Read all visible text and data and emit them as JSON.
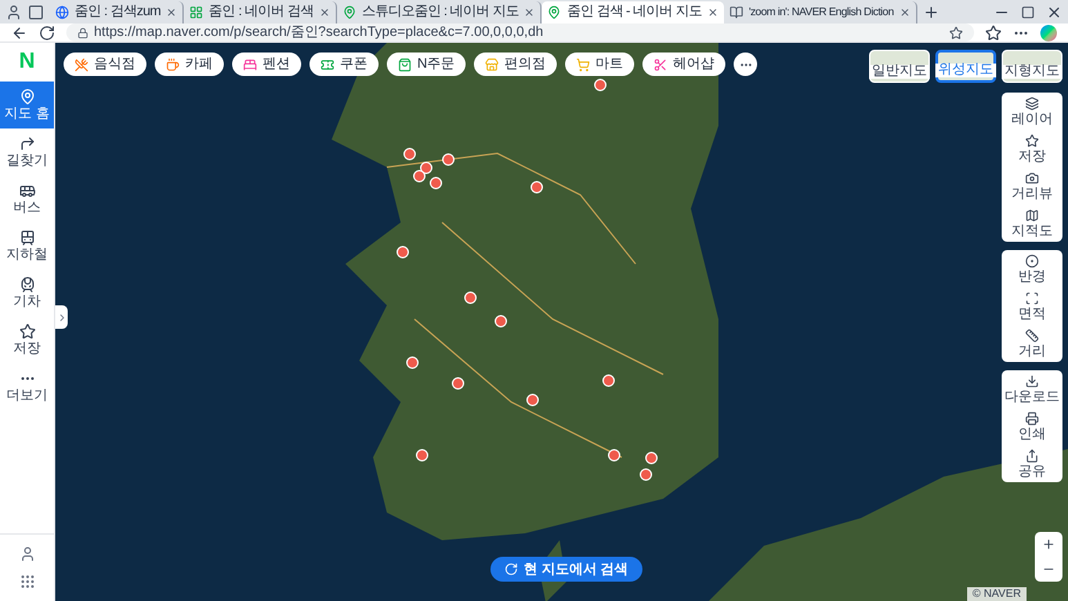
{
  "browser": {
    "tabs": [
      {
        "title": "줌인 : 검색zum",
        "kind": "zum",
        "selected": false
      },
      {
        "title": "줌인 : 네이버 검색",
        "kind": "naver",
        "selected": false
      },
      {
        "title": "스튜디오줌인 : 네이버 지도",
        "kind": "map",
        "selected": false
      },
      {
        "title": "줌인 검색 - 네이버 지도",
        "kind": "map",
        "selected": true
      },
      {
        "title": "'zoom in': NAVER English Diction",
        "kind": "dict",
        "selected": false
      }
    ],
    "url": "https://map.naver.com/p/search/줌인?searchType=place&c=7.00,0,0,0,dh"
  },
  "logo": "N",
  "sidebar": {
    "items": [
      {
        "label": "지도 홈",
        "kind": "home",
        "selected": true
      },
      {
        "label": "길찾기",
        "kind": "directions",
        "selected": false
      },
      {
        "label": "버스",
        "kind": "bus",
        "selected": false
      },
      {
        "label": "지하철",
        "kind": "subway",
        "selected": false
      },
      {
        "label": "기차",
        "kind": "train",
        "selected": false
      },
      {
        "label": "저장",
        "kind": "saved",
        "selected": false
      },
      {
        "label": "더보기",
        "kind": "more",
        "selected": false
      }
    ]
  },
  "categories": [
    {
      "label": "음식점",
      "kind": "restaurant"
    },
    {
      "label": "카페",
      "kind": "cafe"
    },
    {
      "label": "펜션",
      "kind": "pension"
    },
    {
      "label": "쿠폰",
      "kind": "coupon"
    },
    {
      "label": "N주문",
      "kind": "order"
    },
    {
      "label": "편의점",
      "kind": "store"
    },
    {
      "label": "마트",
      "kind": "mart"
    },
    {
      "label": "헤어샵",
      "kind": "hair"
    }
  ],
  "map_types": [
    {
      "label": "일반지도",
      "selected": false
    },
    {
      "label": "위성지도",
      "selected": true
    },
    {
      "label": "지형지도",
      "selected": false
    }
  ],
  "tool_groups": [
    [
      {
        "label": "레이어",
        "kind": "layers"
      },
      {
        "label": "저장",
        "kind": "star"
      },
      {
        "label": "거리뷰",
        "kind": "street"
      },
      {
        "label": "지적도",
        "kind": "cadastral"
      }
    ],
    [
      {
        "label": "반경",
        "kind": "radius"
      },
      {
        "label": "면적",
        "kind": "area"
      },
      {
        "label": "거리",
        "kind": "ruler"
      }
    ],
    [
      {
        "label": "다운로드",
        "kind": "download"
      },
      {
        "label": "인쇄",
        "kind": "print"
      },
      {
        "label": "공유",
        "kind": "share"
      }
    ]
  ],
  "search_here_button": "현 지도에서 검색",
  "copyright": "© NAVER"
}
